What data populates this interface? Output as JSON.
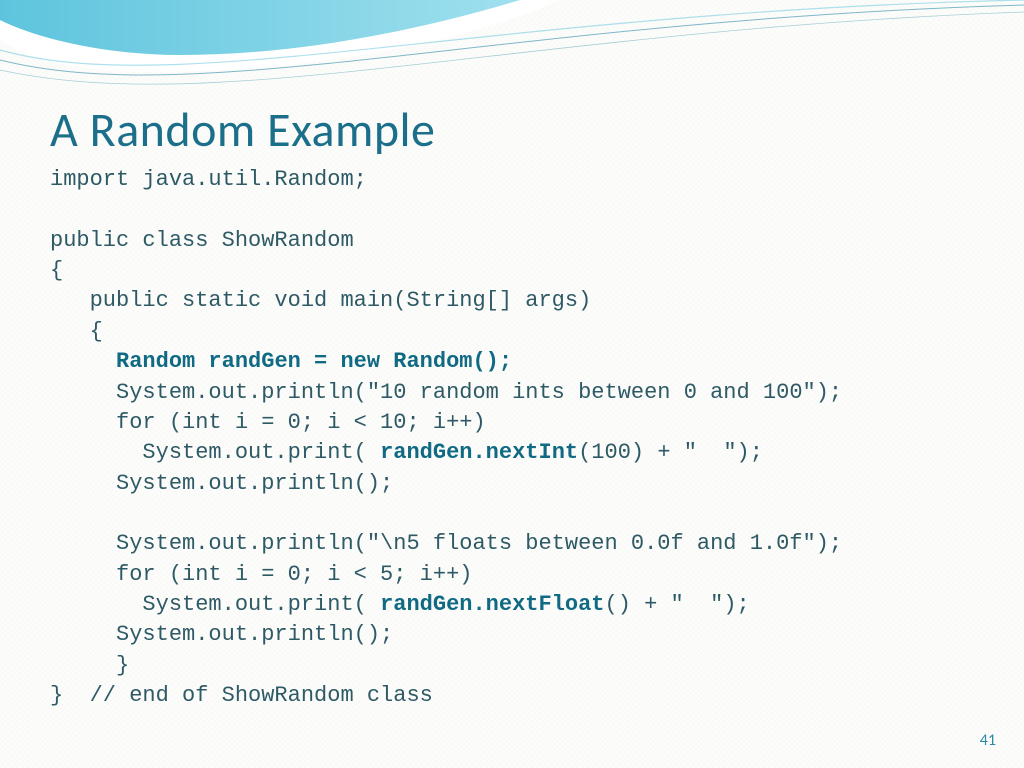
{
  "title": "A Random Example",
  "page_number": "41",
  "code": {
    "l01": "import java.util.Random;",
    "l02": "",
    "l03": "public class ShowRandom",
    "l04": "{",
    "l05": "   public static void main(String[] args)",
    "l06": "   {",
    "l07a": "     ",
    "l07b": "Random randGen = new Random();",
    "l08": "     System.out.println(\"10 random ints between 0 and 100\");",
    "l09": "     for (int i = 0; i < 10; i++)",
    "l10a": "       System.out.print( ",
    "l10b": "randGen.nextInt",
    "l10c": "(100) + \"  \");",
    "l11": "     System.out.println();",
    "l12": "",
    "l13": "     System.out.println(\"\\n5 floats between 0.0f and 1.0f\");",
    "l14": "     for (int i = 0; i < 5; i++)",
    "l15a": "       System.out.print( ",
    "l15b": "randGen.nextFloat",
    "l15c": "() + \"  \");",
    "l16": "     System.out.println();",
    "l17": "     }",
    "l18": "}  // end of ShowRandom class"
  }
}
